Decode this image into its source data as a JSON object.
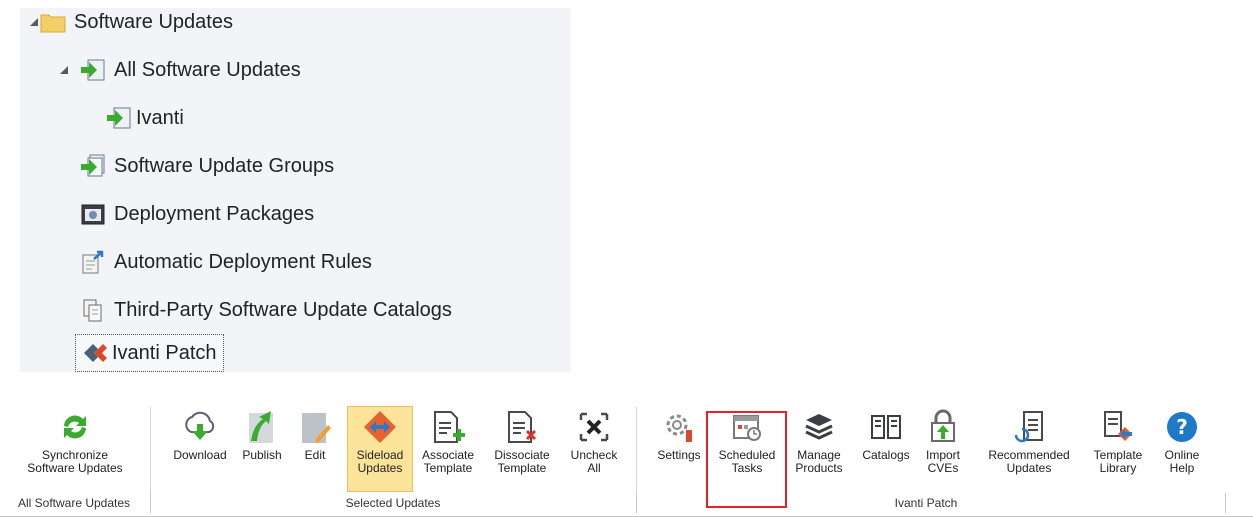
{
  "tree": {
    "items": [
      {
        "label": "Software Updates",
        "icon": "folder-icon"
      },
      {
        "label": "All Software Updates",
        "icon": "software-updates-icon"
      },
      {
        "label": "Ivanti",
        "icon": "software-updates-icon"
      },
      {
        "label": "Software Update Groups",
        "icon": "software-update-groups-icon"
      },
      {
        "label": "Deployment Packages",
        "icon": "deployment-packages-icon"
      },
      {
        "label": "Automatic Deployment Rules",
        "icon": "automatic-deployment-rules-icon"
      },
      {
        "label": "Third-Party Software Update Catalogs",
        "icon": "catalogs-icon"
      },
      {
        "label": "Ivanti Patch",
        "icon": "ivanti-patch-icon"
      }
    ]
  },
  "ribbon": {
    "buttons": [
      {
        "label": "Synchronize\nSoftware Updates",
        "icon": "sync-icon"
      },
      {
        "label": "Download",
        "icon": "download-icon"
      },
      {
        "label": "Publish",
        "icon": "publish-icon"
      },
      {
        "label": "Edit",
        "icon": "edit-icon"
      },
      {
        "label": "Sideload\nUpdates",
        "icon": "sideload-icon"
      },
      {
        "label": "Associate\nTemplate",
        "icon": "associate-template-icon"
      },
      {
        "label": "Dissociate\nTemplate",
        "icon": "dissociate-template-icon"
      },
      {
        "label": "Uncheck\nAll",
        "icon": "uncheck-all-icon"
      },
      {
        "label": "Settings",
        "icon": "settings-icon"
      },
      {
        "label": "Scheduled\nTasks",
        "icon": "scheduled-tasks-icon"
      },
      {
        "label": "Manage\nProducts",
        "icon": "manage-products-icon"
      },
      {
        "label": "Catalogs",
        "icon": "catalogs-book-icon"
      },
      {
        "label": "Import\nCVEs",
        "icon": "import-cves-icon"
      },
      {
        "label": "Recommended\nUpdates",
        "icon": "recommended-updates-icon"
      },
      {
        "label": "Template\nLibrary",
        "icon": "template-library-icon"
      },
      {
        "label": "Online\nHelp",
        "icon": "help-icon"
      }
    ],
    "groups": [
      "All Software Updates",
      "Selected Updates",
      "Ivanti Patch"
    ]
  },
  "colors": {
    "active_button": "#fbe39a",
    "highlight_box": "#e2232a",
    "help_blue": "#1e79c8",
    "green_arrow": "#3bab2f"
  }
}
